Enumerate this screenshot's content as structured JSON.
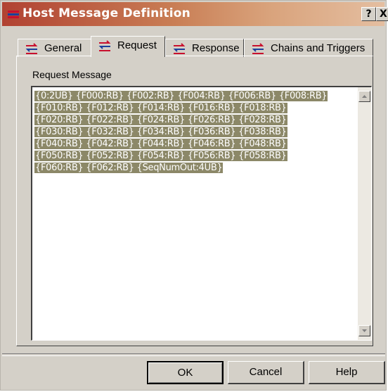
{
  "window": {
    "title": "Host Message Definition",
    "help_button": "?",
    "close_button": "X"
  },
  "tabs": [
    {
      "label": "General",
      "active": false
    },
    {
      "label": "Request",
      "active": true
    },
    {
      "label": "Response",
      "active": false
    },
    {
      "label": "Chains and Triggers",
      "active": false
    }
  ],
  "request": {
    "group_label": "Request Message",
    "lines": [
      "{0:2UB} {F000:RB} {F002:RB} {F004:RB} {F006:RB} {F008:RB}",
      "{F010:RB} {F012:RB} {F014:RB} {F016:RB} {F018:RB}",
      "{F020:RB} {F022:RB} {F024:RB} {F026:RB} {F028:RB}",
      "{F030:RB} {F032:RB} {F034:RB} {F036:RB} {F038:RB}",
      "{F040:RB} {F042:RB} {F044:RB} {F046:RB} {F048:RB}",
      "{F050:RB} {F052:RB} {F054:RB} {F056:RB} {F058:RB}",
      "{F060:RB} {F062:RB} {SeqNumOut:4UB}"
    ]
  },
  "buttons": {
    "ok": "OK",
    "cancel": "Cancel",
    "help": "Help"
  },
  "colors": {
    "title_start": "#b14232",
    "title_end": "#e4bea0",
    "selection": "#8c8868",
    "face": "#d4d0c8"
  }
}
